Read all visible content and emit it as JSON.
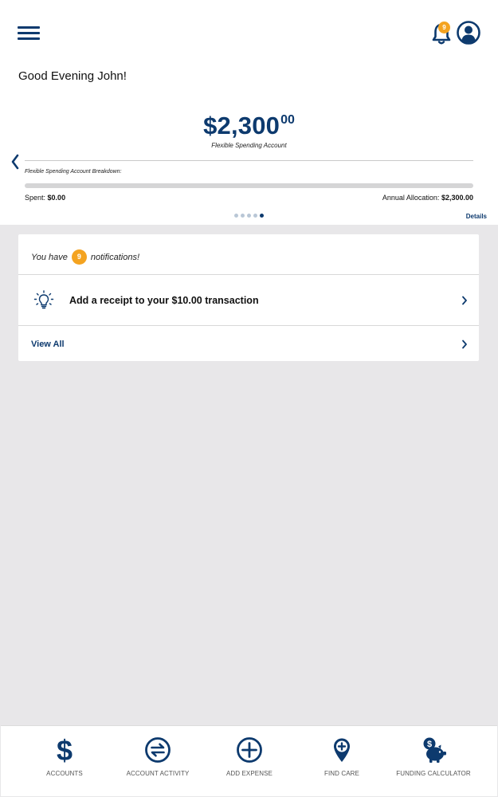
{
  "header": {
    "menu_icon": "hamburger-menu-icon",
    "bell_icon": "bell-icon",
    "notification_count": "9",
    "profile_icon": "user-profile-icon"
  },
  "greeting": "Good Evening John!",
  "account": {
    "balance_main": "$2,300",
    "balance_cents": "00",
    "name": "Flexible Spending Account",
    "breakdown_label": "Flexible Spending Account Breakdown:",
    "spent_label": "Spent:",
    "spent_value": "$0.00",
    "allocation_label": "Annual Allocation:",
    "allocation_value": "$2,300.00",
    "spent_fraction": 0,
    "carousel_pages": 5,
    "carousel_active_index": 4,
    "details_link": "Details"
  },
  "notifications": {
    "prefix": "You have",
    "count": "9",
    "suffix": "notifications!",
    "items": [
      {
        "icon": "lightbulb-icon",
        "text": "Add a receipt to your $10.00 transaction"
      }
    ],
    "view_all": "View All"
  },
  "bottom_nav": [
    {
      "label": "ACCOUNTS",
      "icon": "dollar-icon"
    },
    {
      "label": "ACCOUNT ACTIVITY",
      "icon": "transfer-arrows-icon"
    },
    {
      "label": "ADD EXPENSE",
      "icon": "plus-circle-icon"
    },
    {
      "label": "FIND CARE",
      "icon": "map-pin-plus-icon"
    },
    {
      "label": "FUNDING CALCULATOR",
      "icon": "piggy-bank-icon"
    }
  ],
  "colors": {
    "primary": "#0d3a6e",
    "badge": "#f4a320",
    "background": "#e8e7e9"
  }
}
